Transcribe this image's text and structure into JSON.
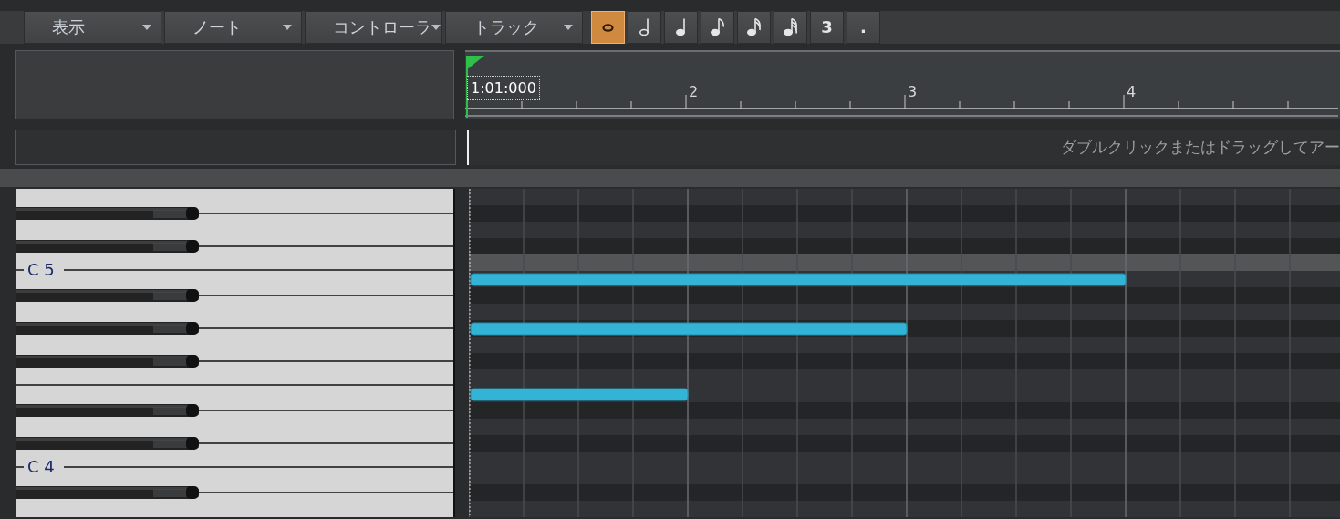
{
  "toolbar": {
    "menus": [
      {
        "label": "表示"
      },
      {
        "label": "ノート"
      },
      {
        "label": "コントローラ"
      },
      {
        "label": "トラック"
      }
    ],
    "note_buttons": [
      {
        "kind": "whole",
        "selected": true
      },
      {
        "kind": "half",
        "selected": false
      },
      {
        "kind": "quarter",
        "selected": false
      },
      {
        "kind": "eighth",
        "selected": false
      },
      {
        "kind": "sixteenth",
        "selected": false
      },
      {
        "kind": "thirtysecond",
        "selected": false
      },
      {
        "kind": "text",
        "text": "3",
        "selected": false
      },
      {
        "kind": "text",
        "text": ".",
        "selected": false
      }
    ]
  },
  "ruler": {
    "position": "1:01:000",
    "measures": [
      "2",
      "3",
      "4"
    ]
  },
  "hint": "ダブルクリックまたはドラッグしてアー",
  "rows": [
    {
      "kind": "white",
      "highlighted": false,
      "notes": []
    },
    {
      "kind": "black",
      "highlighted": false,
      "notes": []
    },
    {
      "kind": "white",
      "highlighted": false,
      "notes": []
    },
    {
      "kind": "black",
      "highlighted": false,
      "notes": []
    },
    {
      "kind": "white",
      "label": "C 5",
      "highlighted": true,
      "notes": []
    },
    {
      "kind": "white",
      "highlighted": false,
      "notes": [
        {
          "level": 0.75
        }
      ]
    },
    {
      "kind": "black",
      "highlighted": false,
      "notes": []
    },
    {
      "kind": "white",
      "highlighted": false,
      "notes": []
    },
    {
      "kind": "black",
      "highlighted": false,
      "notes": [
        {
          "level": 0.5
        }
      ]
    },
    {
      "kind": "white",
      "highlighted": false,
      "notes": []
    },
    {
      "kind": "black",
      "highlighted": false,
      "notes": []
    },
    {
      "kind": "white",
      "highlighted": false,
      "notes": []
    },
    {
      "kind": "white",
      "highlighted": false,
      "notes": [
        {
          "level": 0.25
        }
      ]
    },
    {
      "kind": "black",
      "highlighted": false,
      "notes": []
    },
    {
      "kind": "white",
      "highlighted": false,
      "notes": []
    },
    {
      "kind": "black",
      "highlighted": false,
      "notes": []
    },
    {
      "kind": "white",
      "label": "C 4",
      "highlighted": false,
      "notes": []
    },
    {
      "kind": "white",
      "highlighted": false,
      "notes": []
    },
    {
      "kind": "black",
      "highlighted": false,
      "notes": []
    },
    {
      "kind": "white",
      "highlighted": false,
      "notes": []
    }
  ]
}
